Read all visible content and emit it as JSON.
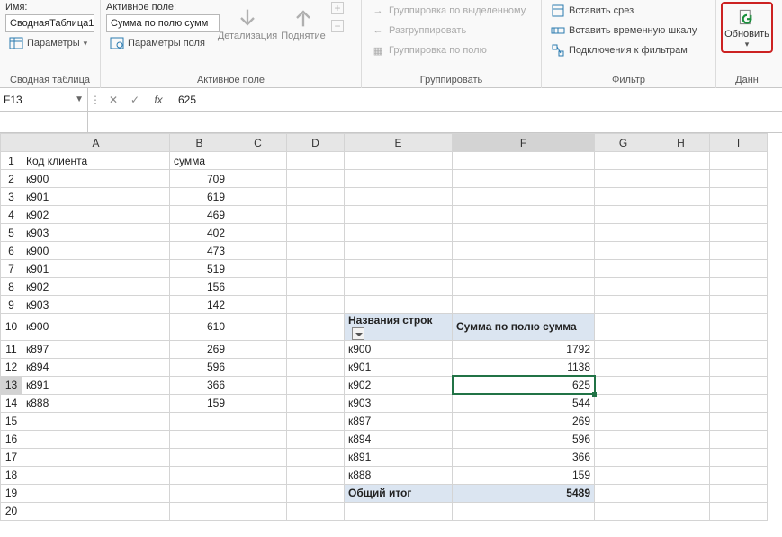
{
  "ribbon": {
    "pivot": {
      "name_label": "Имя:",
      "pivot_name": "СводнаяТаблица1",
      "options_label": "Параметры",
      "group_title": "Сводная таблица"
    },
    "active_field": {
      "label": "Активное поле:",
      "value": "Сумма по полю сумм",
      "field_settings": "Параметры поля",
      "drilldown": "Детализация",
      "drillup": "Поднятие",
      "group_title": "Активное поле"
    },
    "group": {
      "g1": "Группировка по выделенному",
      "g2": "Разгруппировать",
      "g3": "Группировка по полю",
      "group_title": "Группировать"
    },
    "filter": {
      "f1": "Вставить срез",
      "f2": "Вставить временную шкалу",
      "f3": "Подключения к фильтрам",
      "group_title": "Фильтр"
    },
    "data": {
      "refresh": "Обновить",
      "group_title": "Данн"
    }
  },
  "formula_bar": {
    "cell_ref": "F13",
    "content": "625"
  },
  "columns": [
    "A",
    "B",
    "C",
    "D",
    "E",
    "F",
    "G",
    "H",
    "I"
  ],
  "rows_count": 20,
  "sheet": {
    "r1": {
      "A": "Код клиента",
      "B": "сумма"
    },
    "r2": {
      "A": "к900",
      "B": "709"
    },
    "r3": {
      "A": "к901",
      "B": "619"
    },
    "r4": {
      "A": "к902",
      "B": "469"
    },
    "r5": {
      "A": "к903",
      "B": "402"
    },
    "r6": {
      "A": "к900",
      "B": "473"
    },
    "r7": {
      "A": "к901",
      "B": "519"
    },
    "r8": {
      "A": "к902",
      "B": "156"
    },
    "r9": {
      "A": "к903",
      "B": "142"
    },
    "r10": {
      "A": "к900",
      "B": "610",
      "E": "Названия строк",
      "F": "Сумма по полю сумма"
    },
    "r11": {
      "A": "к897",
      "B": "269",
      "E": "к900",
      "F": "1792"
    },
    "r12": {
      "A": "к894",
      "B": "596",
      "E": "к901",
      "F": "1138"
    },
    "r13": {
      "A": "к891",
      "B": "366",
      "E": "к902",
      "F": "625"
    },
    "r14": {
      "A": "к888",
      "B": "159",
      "E": "к903",
      "F": "544"
    },
    "r15": {
      "E": "к897",
      "F": "269"
    },
    "r16": {
      "E": "к894",
      "F": "596"
    },
    "r17": {
      "E": "к891",
      "F": "366"
    },
    "r18": {
      "E": "к888",
      "F": "159"
    },
    "r19": {
      "E": "Общий итог",
      "F": "5489"
    }
  },
  "active_cell": "F13",
  "chart_data": {
    "type": "table",
    "title": "Сводная таблица",
    "columns": [
      "Названия строк",
      "Сумма по полю сумма"
    ],
    "rows": [
      [
        "к900",
        1792
      ],
      [
        "к901",
        1138
      ],
      [
        "к902",
        625
      ],
      [
        "к903",
        544
      ],
      [
        "к897",
        269
      ],
      [
        "к894",
        596
      ],
      [
        "к891",
        366
      ],
      [
        "к888",
        159
      ]
    ],
    "total_label": "Общий итог",
    "total_value": 5489
  }
}
